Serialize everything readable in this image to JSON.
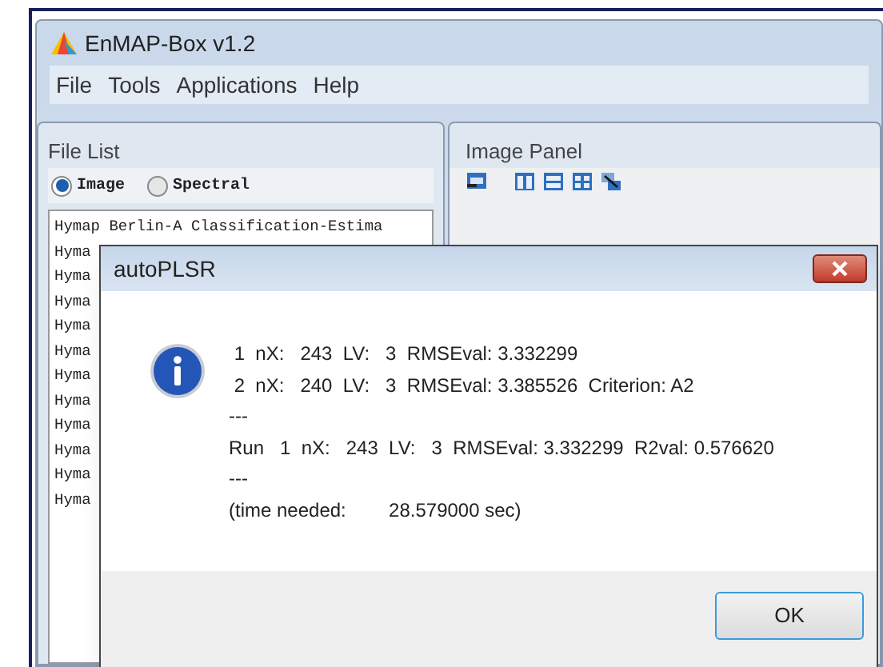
{
  "window": {
    "title": "EnMAP-Box v1.2"
  },
  "menu": [
    "File",
    "Tools",
    "Applications",
    "Help"
  ],
  "file_list": {
    "title": "File List",
    "radios": [
      {
        "label": "Image",
        "selected": true
      },
      {
        "label": "Spectral",
        "selected": false
      }
    ],
    "items": [
      "Hymap Berlin-A Classification-Estima",
      "Hyma",
      "Hyma",
      "Hyma",
      "Hyma",
      "Hyma",
      "Hyma",
      "Hyma",
      "Hyma",
      "Hyma",
      "Hyma",
      "Hyma"
    ]
  },
  "image_panel": {
    "title": "Image Panel"
  },
  "dialog": {
    "title": "autoPLSR",
    "lines": [
      " 1  nX:   243  LV:   3  RMSEval: 3.332299",
      " 2  nX:   240  LV:   3  RMSEval: 3.385526  Criterion: A2",
      "---",
      "Run   1  nX:   243  LV:   3  RMSEval: 3.332299  R2val: 0.576620",
      "---",
      "(time needed:        28.579000 sec)"
    ],
    "button": "OK"
  }
}
